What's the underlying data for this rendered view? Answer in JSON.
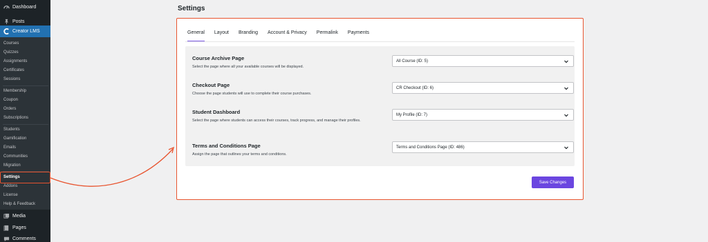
{
  "sidebar": {
    "dashboard": "Dashboard",
    "posts": "Posts",
    "creator_lms": "Creator LMS",
    "submenu": {
      "courses": "Courses",
      "quizzes": "Quizzes",
      "assignments": "Assignments",
      "certificates": "Certificates",
      "sessions": "Sessions",
      "membership": "Membership",
      "coupon": "Coupon",
      "orders": "Orders",
      "subscriptions": "Subscriptions",
      "students": "Students",
      "gamification": "Gamification",
      "emails": "Emails",
      "communities": "Communities",
      "migration": "Migration",
      "settings": "Settings",
      "addons": "Addons",
      "license": "License",
      "help": "Help & Feedback"
    },
    "media": "Media",
    "pages": "Pages",
    "comments": "Comments"
  },
  "page": {
    "title": "Settings"
  },
  "tabs": [
    "General",
    "Layout",
    "Branding",
    "Account & Privacy",
    "Permalink",
    "Payments"
  ],
  "rows": [
    {
      "title": "Course Archive Page",
      "desc": "Select the page where all your available courses will be displayed.",
      "value": "All Course (ID: 5)"
    },
    {
      "title": "Checkout Page",
      "desc": "Choose the page students will use to complete their course purchases.",
      "value": "CR Checkout (ID: 6)"
    },
    {
      "title": "Student Dashboard",
      "desc": "Select the page where students can access their courses, track progress, and manage their profiles.",
      "value": "My Profile (ID: 7)"
    },
    {
      "title": "Terms and Conditions Page",
      "desc": "Assign the page that outlines your terms and conditions.",
      "value": "Terms and Conditions Page (ID: 486)"
    }
  ],
  "save_label": "Save Changes",
  "colors": {
    "accent": "#6b46e0",
    "highlight": "#e8542f",
    "sidebar_bg": "#1d2327",
    "sidebar_active": "#2271b1"
  },
  "icons": {
    "dashboard": "dashboard-icon",
    "posts": "pin-icon",
    "creator_lms": "creator-lms-icon",
    "media": "media-icon",
    "pages": "pages-icon",
    "comments": "comments-icon",
    "select": "chevron-down-icon"
  }
}
